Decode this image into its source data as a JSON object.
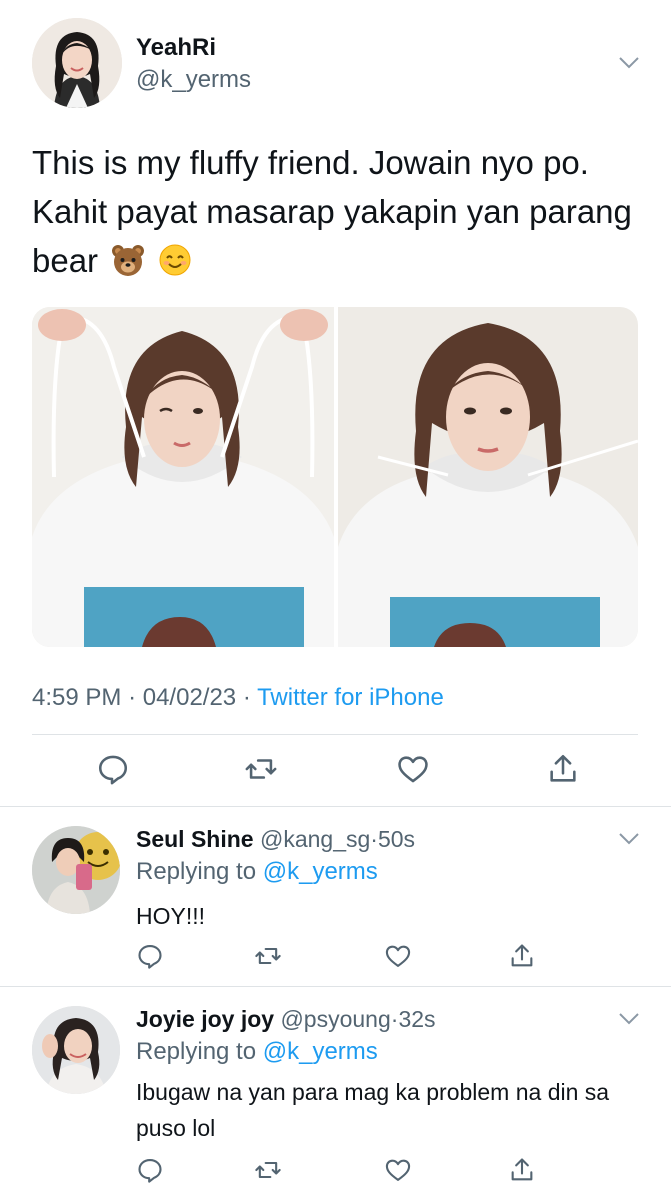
{
  "main_tweet": {
    "author_name": "YeahRi",
    "author_handle": "@k_yerms",
    "text": "This is my fluffy friend. Jowain nyo po. Kahit payat masarap yakapin yan parang bear",
    "text_emojis": [
      "bear-face-emoji",
      "smiling-face-emoji"
    ],
    "time": "4:59 PM",
    "separator": "·",
    "date": "04/02/23",
    "source": "Twitter for iPhone",
    "media_count": 2
  },
  "replies": [
    {
      "author_name": "Seul Shine",
      "author_handle": "@kang_sg",
      "separator": "·",
      "time": "50s",
      "replying_prefix": "Replying to",
      "replying_to": "@k_yerms",
      "text": "HOY!!!"
    },
    {
      "author_name": "Joyie joy joy",
      "author_handle": "@psyoung",
      "separator": "·",
      "time": "32s",
      "replying_prefix": "Replying to",
      "replying_to": "@k_yerms",
      "text": "Ibugaw na yan para mag ka problem na din sa puso lol"
    }
  ],
  "actions": [
    "reply-icon",
    "retweet-icon",
    "like-icon",
    "share-icon"
  ],
  "colors": {
    "text": "#0f1419",
    "muted": "#536471",
    "link": "#1d9bf0",
    "divider": "#dfe3e6"
  }
}
